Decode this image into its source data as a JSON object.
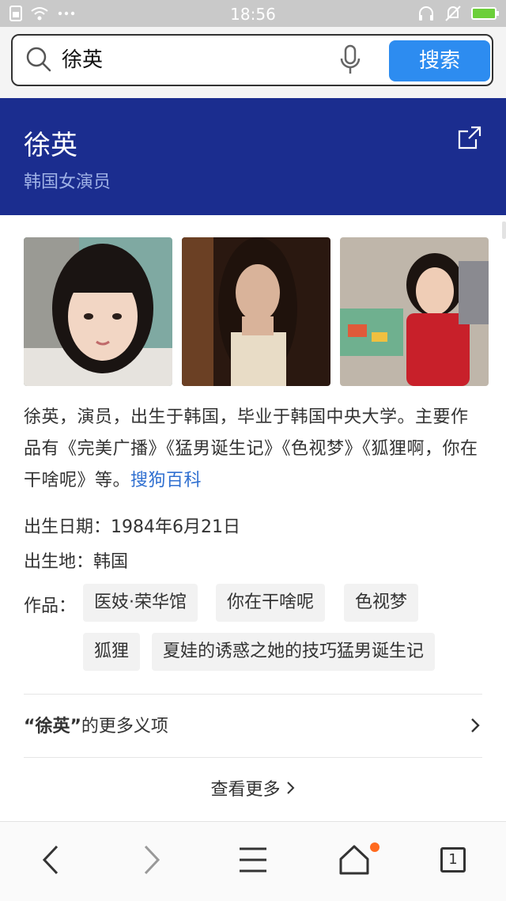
{
  "status_bar": {
    "time": "18:56",
    "icons": [
      "sim-icon",
      "wifi-icon",
      "more-dots-icon",
      "headphones-icon",
      "mute-icon",
      "battery-icon"
    ]
  },
  "search": {
    "query": "徐英",
    "button_label": "搜索"
  },
  "header": {
    "name": "徐英",
    "subtitle": "韩国女演员"
  },
  "summary": {
    "text": "徐英，演员，出生于韩国，毕业于韩国中央大学。主要作品有《完美广播》《猛男诞生记》《色视梦》《狐狸啊，你在干啥呢》等。",
    "link": "搜狗百科"
  },
  "info": {
    "birth_date": "出生日期：1984年6月21日",
    "birth_place": "出生地：韩国",
    "works_label": "作品："
  },
  "works": [
    "医妓·荣华馆",
    "你在干啥呢",
    "色视梦",
    "狐狸",
    "夏娃的诱惑之她的技巧猛男诞生记"
  ],
  "more_senses": {
    "keyword": "“徐英”",
    "suffix": "的更多义项"
  },
  "view_more": "查看更多",
  "bottom_nav": {
    "tab_count": "1"
  },
  "colors": {
    "header_bg": "#1b2d8f",
    "search_button": "#2d8cf0",
    "link": "#2f6fd0",
    "notify_dot": "#ff6a1f"
  }
}
